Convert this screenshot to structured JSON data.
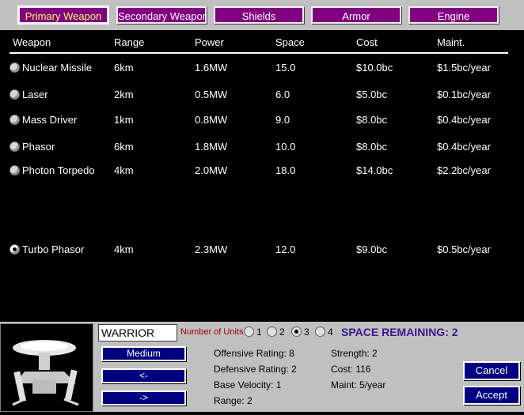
{
  "tabs": [
    {
      "label": "Primary Weapon",
      "active": true
    },
    {
      "label": "Secondary Weapon",
      "active": false
    },
    {
      "label": "Shields",
      "active": false
    },
    {
      "label": "Armor",
      "active": false
    },
    {
      "label": "Engine",
      "active": false
    }
  ],
  "table": {
    "headers": [
      "Weapon",
      "Range",
      "Power",
      "Space",
      "Cost",
      "Maint."
    ],
    "rows": [
      {
        "name": "Nuclear Missile",
        "range": "6km",
        "power": "1.6MW",
        "space": "15.0",
        "cost": "$10.0bc",
        "maint": "$1.5bc/year",
        "selected": false
      },
      {
        "name": "Laser",
        "range": "2km",
        "power": "0.5MW",
        "space": "6.0",
        "cost": "$5.0bc",
        "maint": "$0.1bc/year",
        "selected": false
      },
      {
        "name": "Mass Driver",
        "range": "1km",
        "power": "0.8MW",
        "space": "9.0",
        "cost": "$8.0bc",
        "maint": "$0.4bc/year",
        "selected": false
      },
      {
        "name": "Phasor",
        "range": "6km",
        "power": "1.8MW",
        "space": "10.0",
        "cost": "$8.0bc",
        "maint": "$0.4bc/year",
        "selected": false
      },
      {
        "name": "Photon Torpedo",
        "range": "4km",
        "power": "2.0MW",
        "space": "18.0",
        "cost": "$14.0bc",
        "maint": "$2.2bc/year",
        "selected": false
      },
      {
        "name": "Turbo Phasor",
        "range": "4km",
        "power": "2.3MW",
        "space": "12.0",
        "cost": "$9.0bc",
        "maint": "$0.5bc/year",
        "selected": true
      }
    ]
  },
  "ship": {
    "name": "WARRIOR",
    "units_label": "Number of Units",
    "unit_options": [
      "1",
      "2",
      "3",
      "4"
    ],
    "units_selected": "3",
    "space_remaining": "SPACE REMAINING: 2",
    "size_label": "Medium",
    "prev_label": "<-",
    "next_label": "->",
    "stats_left": [
      "Offensive Rating: 8",
      "Defensive Rating: 2",
      "Base Velocity: 1",
      "Range: 2"
    ],
    "stats_right": [
      "Strength: 2",
      "Cost: 116",
      "Maint: 5/year"
    ],
    "cancel_label": "Cancel",
    "accept_label": "Accept"
  },
  "colors": {
    "tab_bg": "#800080",
    "button_bg": "#000080",
    "panel_bg": "#c0c0c0",
    "space_text": "#3a1a8a",
    "units_label": "#a00000"
  }
}
